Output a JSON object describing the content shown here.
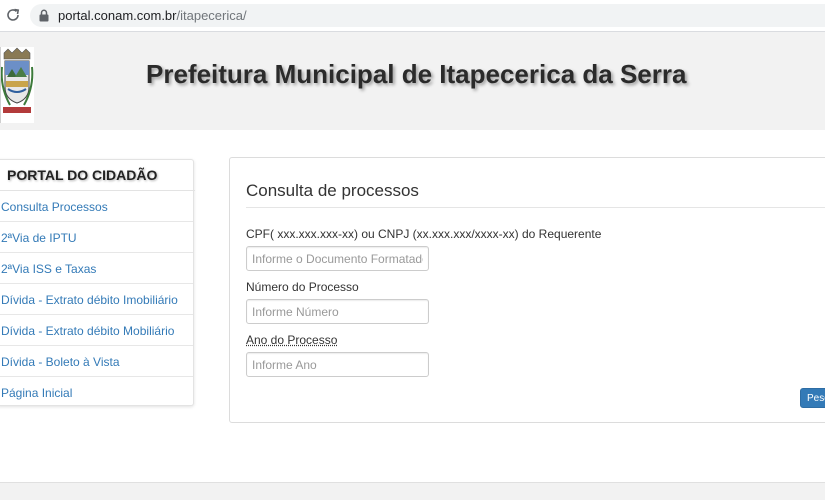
{
  "browser": {
    "url_host": "portal.conam.com.br",
    "url_path": "/itapecerica/"
  },
  "header": {
    "title": "Prefeitura Municipal de Itapecerica da Serra"
  },
  "sidebar": {
    "title": "PORTAL DO CIDADÃO",
    "items": [
      {
        "label": "Consulta Processos"
      },
      {
        "label": "2ªVia de IPTU"
      },
      {
        "label": "2ªVia ISS e Taxas"
      },
      {
        "label": "Dívida - Extrato débito Imobiliário"
      },
      {
        "label": "Dívida - Extrato débito Mobiliário"
      },
      {
        "label": "Dívida - Boleto à Vista"
      },
      {
        "label": "Página Inicial"
      }
    ]
  },
  "form": {
    "title": "Consulta de processos",
    "document": {
      "label": "CPF( xxx.xxx.xxx-xx) ou CNPJ (xx.xxx.xxx/xxxx-xx) do Requerente",
      "placeholder": "Informe o Documento Formatado",
      "value": ""
    },
    "number": {
      "label": "Número do Processo",
      "placeholder": "Informe Número",
      "value": ""
    },
    "year": {
      "label": "Ano do Processo",
      "placeholder": "Informe Ano",
      "value": ""
    },
    "search_button": "Pesq"
  },
  "icons": {
    "reload": "reload-icon",
    "lock": "lock-icon",
    "crest": "coat-of-arms-logo"
  },
  "colors": {
    "link": "#337ab7",
    "button": "#337ab7",
    "header_bg": "#f2f2f2"
  }
}
